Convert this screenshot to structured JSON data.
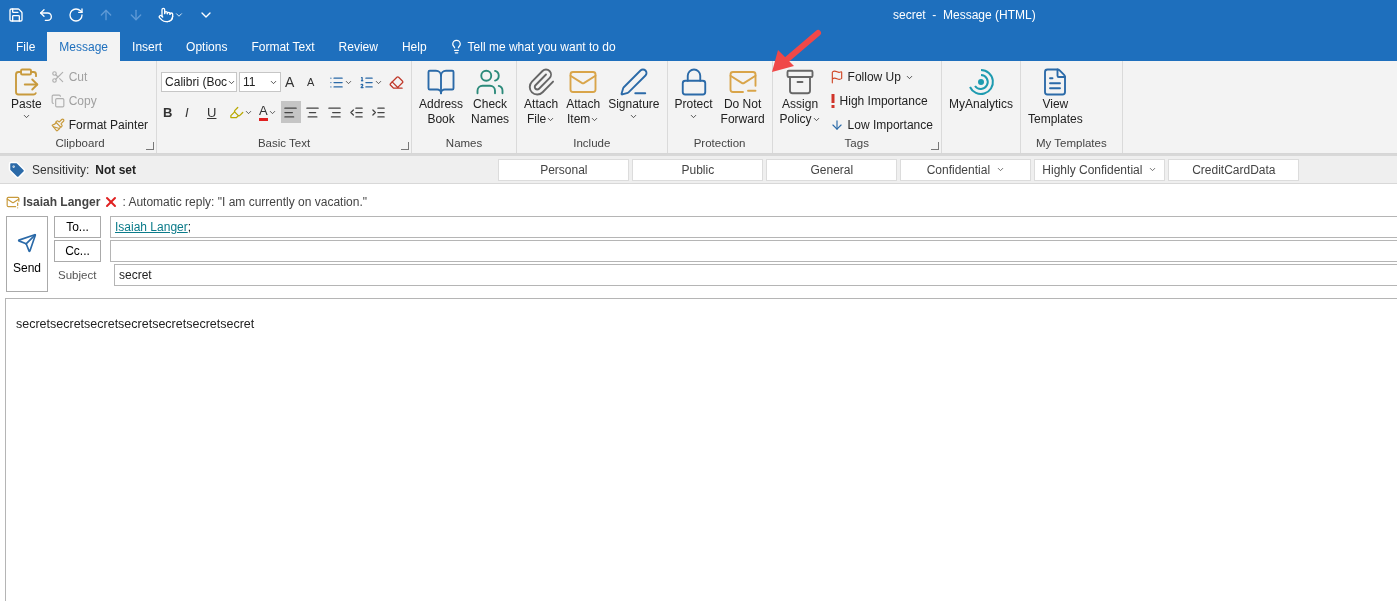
{
  "window": {
    "title": "secret  -  Message (HTML)"
  },
  "quick_access": [
    {
      "disabled": false
    },
    {
      "disabled": false
    },
    {
      "disabled": false
    },
    {
      "disabled": true
    },
    {
      "disabled": true
    },
    {
      "disabled": false,
      "dropdown": true
    },
    {
      "disabled": false
    }
  ],
  "tabs": [
    {
      "label": "File",
      "selected": false
    },
    {
      "label": "Message",
      "selected": true
    },
    {
      "label": "Insert",
      "selected": false
    },
    {
      "label": "Options",
      "selected": false
    },
    {
      "label": "Format Text",
      "selected": false
    },
    {
      "label": "Review",
      "selected": false
    },
    {
      "label": "Help",
      "selected": false
    }
  ],
  "tell_me": {
    "placeholder": "Tell me what you want to do"
  },
  "ribbon": [
    {
      "label": "Clipboard",
      "launcher": true,
      "items": [
        {
          "kind": "large",
          "lines": [
            "Paste"
          ],
          "dropdown": true
        },
        {
          "kind": "stack",
          "entries": [
            {
              "label": "Cut",
              "disabled": true
            },
            {
              "label": "Copy",
              "disabled": true
            },
            {
              "label": "Format Painter",
              "disabled": false
            }
          ]
        }
      ]
    },
    {
      "label": "Basic Text",
      "launcher": true,
      "items": [
        {
          "kind": "font",
          "font": "Calibri (Boc",
          "size": "11",
          "row1": [
            {
              "glyph": "A",
              "dropdown": false
            },
            {
              "glyph": "A",
              "dropdown": false
            },
            {
              "dropdown": true
            },
            {
              "dropdown": true
            },
            {
              "dropdown": false
            }
          ],
          "row2": [
            {
              "glyph": "B",
              "dropdown": false,
              "selected": false
            },
            {
              "glyph": "I",
              "dropdown": false,
              "selected": false
            },
            {
              "glyph": "U",
              "dropdown": false,
              "selected": false
            },
            {
              "dropdown": true,
              "selected": false
            },
            {
              "glyph": "A",
              "dropdown": true,
              "selected": false
            },
            {
              "dropdown": false,
              "selected": true
            },
            {
              "dropdown": false,
              "selected": false
            },
            {
              "dropdown": false,
              "selected": false
            },
            {
              "dropdown": false,
              "selected": false
            },
            {
              "dropdown": false,
              "selected": false
            }
          ]
        }
      ]
    },
    {
      "label": "Names",
      "launcher": false,
      "items": [
        {
          "kind": "large",
          "lines": [
            "Address",
            "Book"
          ],
          "dropdown": false
        },
        {
          "kind": "large",
          "lines": [
            "Check",
            "Names"
          ],
          "dropdown": false
        }
      ]
    },
    {
      "label": "Include",
      "launcher": false,
      "items": [
        {
          "kind": "large",
          "lines": [
            "Attach",
            "File"
          ],
          "dropdown": true
        },
        {
          "kind": "large",
          "lines": [
            "Attach",
            "Item"
          ],
          "dropdown": true
        },
        {
          "kind": "large",
          "lines": [
            "Signature"
          ],
          "dropdown": true
        }
      ]
    },
    {
      "label": "Protection",
      "launcher": false,
      "items": [
        {
          "kind": "large",
          "lines": [
            "Protect"
          ],
          "dropdown": true
        },
        {
          "kind": "large",
          "lines": [
            "Do Not",
            "Forward"
          ],
          "dropdown": false
        }
      ]
    },
    {
      "label": "Tags",
      "launcher": true,
      "items": [
        {
          "kind": "large",
          "lines": [
            "Assign",
            "Policy"
          ],
          "dropdown": true
        },
        {
          "kind": "stack",
          "entries": [
            {
              "label": "Follow Up",
              "disabled": false,
              "dropdown": true
            },
            {
              "label": "High Importance",
              "disabled": false
            },
            {
              "label": "Low Importance",
              "disabled": false
            }
          ]
        }
      ]
    },
    {
      "launcher": false,
      "items": [
        {
          "kind": "large",
          "lines": [
            "MyAnalytics"
          ],
          "dropdown": false
        }
      ]
    },
    {
      "label": "My Templates",
      "launcher": false,
      "items": [
        {
          "kind": "large",
          "lines": [
            "View",
            "Templates"
          ],
          "dropdown": false
        }
      ]
    }
  ],
  "sensitivity": {
    "label": "Sensitivity:",
    "value": "Not set",
    "options": [
      {
        "label": "Personal",
        "dropdown": false
      },
      {
        "label": "Public",
        "dropdown": false
      },
      {
        "label": "General",
        "dropdown": false
      },
      {
        "label": "Confidential",
        "dropdown": true
      },
      {
        "label": "Highly Confidential",
        "dropdown": true
      },
      {
        "label": "CreditCardData",
        "dropdown": false
      }
    ]
  },
  "info_bar": {
    "name": "Isaiah Langer",
    "text": ": Automatic reply: \"I am currently on vacation.\""
  },
  "header": {
    "send": "Send",
    "to_button": "To...",
    "to_value": "Isaiah Langer",
    "to_suffix": ";",
    "cc_button": "Cc...",
    "subject_label": "Subject",
    "subject_value": "secret"
  },
  "body": {
    "text": "secretsecretsecretsecretsecretsecretsecret"
  }
}
